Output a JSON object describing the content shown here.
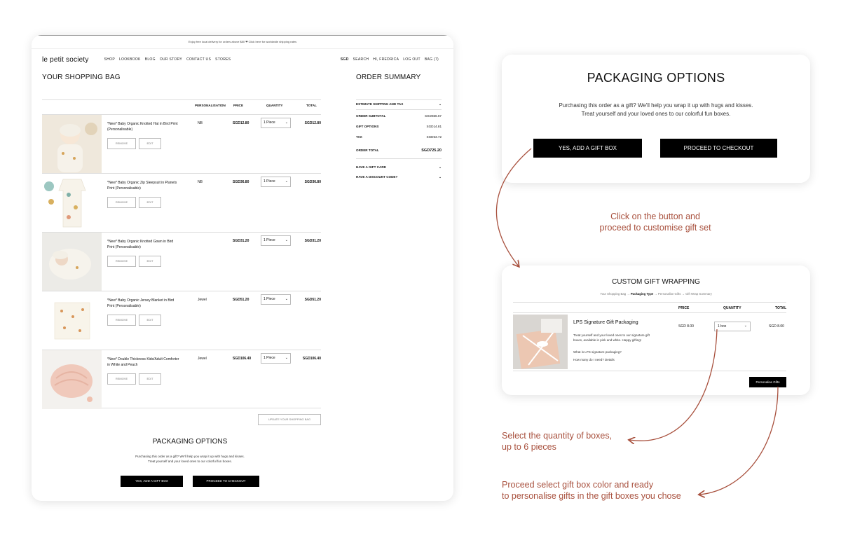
{
  "shop": {
    "topbar": "Enjoy free local delivery for orders above $80 ❤ Click here for worldwide shipping rates",
    "logo": "le petit society",
    "nav": [
      "SHOP",
      "LOOKBOOK",
      "BLOG",
      "OUR STORY",
      "CONTACT US",
      "STORES"
    ],
    "nav_right": [
      "SGD",
      "SEARCH",
      "HI, FREDRICA",
      "LOG OUT",
      "BAG (7)"
    ],
    "bag_title": "YOUR SHOPPING BAG",
    "columns": {
      "personalisation": "PERSONALISATION",
      "price": "PRICE",
      "quantity": "QUANTITY",
      "total": "TOTAL"
    },
    "remove_label": "REMOVE",
    "edit_label": "EDIT",
    "items": [
      {
        "name": "*New* Baby Organic Knotted Hat in Bird Print (Personalisable)",
        "personalisation": "NB",
        "price": "SGD12.80",
        "qty": "1 Piece",
        "total": "SGD12.80"
      },
      {
        "name": "*New* Baby Organic Zip Sleepsuit in Planets Print (Personalisable)",
        "personalisation": "NB",
        "price": "SGD36.80",
        "qty": "1 Piece",
        "total": "SGD36.80"
      },
      {
        "name": "*New* Baby Organic Knotted Gown in Bird Print (Personalisable)",
        "personalisation": "",
        "price": "SGD31.20",
        "qty": "1 Piece",
        "total": "SGD31.20"
      },
      {
        "name": "*New* Baby Organic Jersey Blanket in Bird Print (Personalisable)",
        "personalisation": "Jewel",
        "price": "SGD51.20",
        "qty": "1 Piece",
        "total": "SGD51.20"
      },
      {
        "name": "*New* Double Thickness Kids/Adult Comforter in White and Peach",
        "personalisation": "Jewel",
        "price": "SGD106.40",
        "qty": "1 Piece",
        "total": "SGD106.40"
      }
    ],
    "update_label": "UPDATE YOUR SHOPPING BAG",
    "packaging_title": "PACKAGING OPTIONS",
    "packaging_text1": "Purchasing this order as a gift? We'll help you wrap it up with hugs and kisses.",
    "packaging_text2": "Treat yourself and your loved ones to our colorful fun boxes.",
    "gift_btn": "YES, ADD A GIFT BOX",
    "checkout_btn": "PROCEED TO CHECKOUT"
  },
  "summary": {
    "title": "ORDER SUMMARY",
    "estimate": "ESTIMATE SHIPPING AND TAX",
    "subtotal_label": "ORDER SUBTOTAL",
    "subtotal": "SGD656.67",
    "gift_label": "GIFT OPTIONS",
    "gift": "SGD14.81",
    "tax_label": "TAX",
    "tax": "SGD53.72",
    "total_label": "ORDER TOTAL",
    "total": "SGD725.20",
    "gift_card": "HAVE A GIFT CARD",
    "discount": "HAVE A DISCOUNT CODE?"
  },
  "pack": {
    "title": "PACKAGING OPTIONS",
    "text1": "Purchasing this order as a gift? We'll help you wrap it up with hugs and kisses.",
    "text2": "Treat yourself and your loved ones to our colorful fun boxes.",
    "gift_btn": "YES, ADD A GIFT BOX",
    "checkout_btn": "PROCEED TO CHECKOUT"
  },
  "gift": {
    "title": "CUSTOM GIFT WRAPPING",
    "steps": [
      "Your Shopping Bag",
      "Packaging Type",
      "Personalise Gifts",
      "Gift Wrap Summary"
    ],
    "columns": {
      "price": "PRICE",
      "quantity": "QUANTITY",
      "total": "TOTAL"
    },
    "item_name": "LPS Signature Gift Packaging",
    "item_desc": "Treat yourself and your loved ones to our signature gift boxes, available in pink and white. Happy gifting!",
    "link1": "What is LPS signature packaging?",
    "link2": "How many do I need? Details",
    "price": "SGD 8.00",
    "qty": "1 box",
    "total": "SGD 8.00",
    "personalise_btn": "Personalise Gifts"
  },
  "annotations": {
    "a1_line1": "Click on the button and",
    "a1_line2": "proceed to customise gift set",
    "a2_line1": "Select the quantity of boxes,",
    "a2_line2": "up to 6 pieces",
    "a3_line1": "Proceed select gift box color and ready",
    "a3_line2": "to personalise gifts in the gift boxes you chose"
  },
  "colors": {
    "accent": "#a8503d",
    "button": "#000000"
  }
}
